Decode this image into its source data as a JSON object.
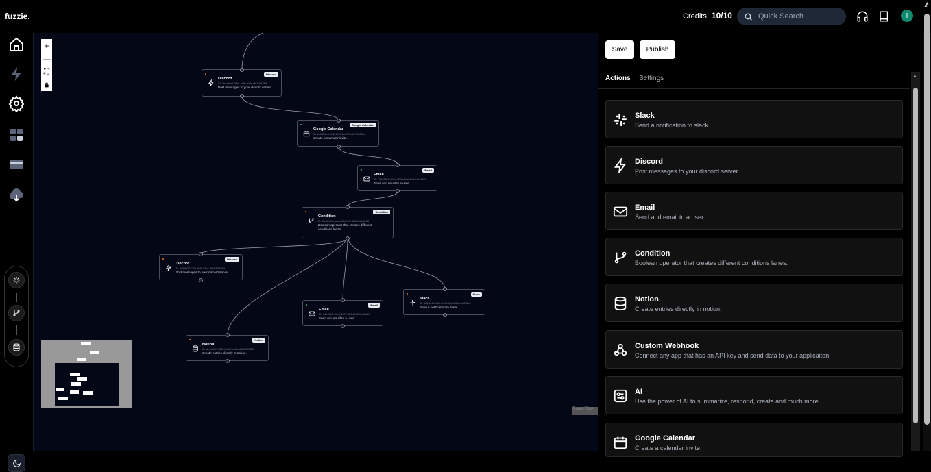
{
  "app": {
    "logo": "fuzzie."
  },
  "header": {
    "credits_label": "Credits",
    "credits_value": "10/10",
    "search_placeholder": "Quick Search",
    "avatar_initial": "I"
  },
  "canvas": {
    "controls": [
      "+",
      "—",
      "⛶",
      "🔒"
    ],
    "nodes": [
      {
        "title": "Discord",
        "badge": "Discord",
        "id": "ID: 7b2a9ce4-3f1b-4a8e-a5fa-ef81cf60f8f8",
        "desc": "Post messages to your discord server",
        "dot": "#f97316"
      },
      {
        "title": "Google Calendar",
        "badge": "Google Calendar",
        "id": "ID: bc50b4e8-6d9f-41c5-8e5f-9cab771529ba",
        "desc": "Create a calendar invite.",
        "dot": "#22c55e"
      },
      {
        "title": "Email",
        "badge": "Email",
        "id": "ID: 732e8603-7b5e-42f9-a4ba-9e8be1c2b2f1",
        "desc": "Send and email to a user",
        "dot": "#22c55e"
      },
      {
        "title": "Condition",
        "badge": "Condition",
        "id": "ID: f5e58e44-eaaa-4ff1-9ef9-3b8a9a8c0e38",
        "desc": "Boolean operator that creates different conditions lanes.",
        "dot": "#f97316"
      },
      {
        "title": "Discord",
        "badge": "Discord",
        "id": "ID: 2c9f6a36-2f2b-4b8f-b2aa-3f89f3f68d5d",
        "desc": "Post messages to your discord server",
        "dot": "#f97316"
      },
      {
        "title": "Email",
        "badge": "Email",
        "id": "ID: e4a12fc9-9ce0-4d77-8b1d-16f3f0e9dc6f",
        "desc": "Send and email to a user",
        "dot": "#22c55e"
      },
      {
        "title": "Slack",
        "badge": "Slack",
        "id": "ID: 3d6f4e2c-9d8e-4e1e-8a90-6d0ce88ff1c4",
        "desc": "Send a notification to slack",
        "dot": "#f97316"
      },
      {
        "title": "Notion",
        "badge": "Notion",
        "id": "ID: de1c60a7-f85b-4406-9aa3-dd8f8d09854b",
        "desc": "Create entries directly in notion.",
        "dot": "#f97316"
      }
    ]
  },
  "panel": {
    "save_label": "Save",
    "publish_label": "Publish",
    "tabs": [
      "Actions",
      "Settings"
    ],
    "cards": [
      {
        "icon": "slack-icon",
        "title": "Slack",
        "desc": "Send a notification to slack"
      },
      {
        "icon": "discord-icon",
        "title": "Discord",
        "desc": "Post messages to your discord server"
      },
      {
        "icon": "mail-icon",
        "title": "Email",
        "desc": "Send and email to a user"
      },
      {
        "icon": "git-branch-icon",
        "title": "Condition",
        "desc": "Boolean operator that creates different conditions lanes."
      },
      {
        "icon": "database-icon",
        "title": "Notion",
        "desc": "Create entries directly in notion."
      },
      {
        "icon": "webhook-icon",
        "title": "Custom Webhook",
        "desc": "Connect any app that has an API key and send data to your applicaiton."
      },
      {
        "icon": "ai-icon",
        "title": "AI",
        "desc": "Use the power of AI to summarize, respond, create and much more."
      },
      {
        "icon": "calendar-icon",
        "title": "Google Calendar",
        "desc": "Create a calendar invite."
      }
    ]
  },
  "attribution": "React Flow"
}
